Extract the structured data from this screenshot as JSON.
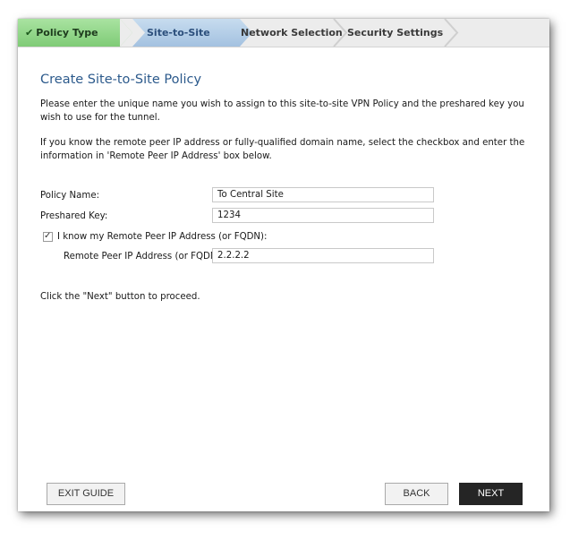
{
  "steps": [
    {
      "label": "Policy Type",
      "check": "✔"
    },
    {
      "label": "Site-to-Site"
    },
    {
      "label": "Network Selection"
    },
    {
      "label": "Security Settings"
    }
  ],
  "colors": {
    "step_done": "#8fd486",
    "step_active": "#b3cde6",
    "title": "#2c5a8c",
    "next_button": "#252525"
  },
  "page": {
    "title": "Create Site-to-Site Policy",
    "intro1": "Please enter the unique name you wish to assign to this site-to-site VPN Policy and the preshared key you wish to use for the tunnel.",
    "intro2": "If you know the remote peer IP address or fully-qualified domain name, select the checkbox and enter the information in 'Remote Peer IP Address' box below.",
    "proceed": "Click the \"Next\" button to proceed."
  },
  "form": {
    "policy_name_label": "Policy Name:",
    "policy_name_value": "To Central Site",
    "preshared_key_label": "Preshared Key:",
    "preshared_key_value": "1234",
    "know_peer_label": "I know my Remote Peer IP Address (or FQDN):",
    "know_peer_checked": true,
    "check_glyph": "✓",
    "remote_peer_label": "Remote Peer IP Address (or FQDN):",
    "remote_peer_value": "2.2.2.2"
  },
  "buttons": {
    "exit": "EXIT GUIDE",
    "back": "BACK",
    "next": "NEXT"
  }
}
